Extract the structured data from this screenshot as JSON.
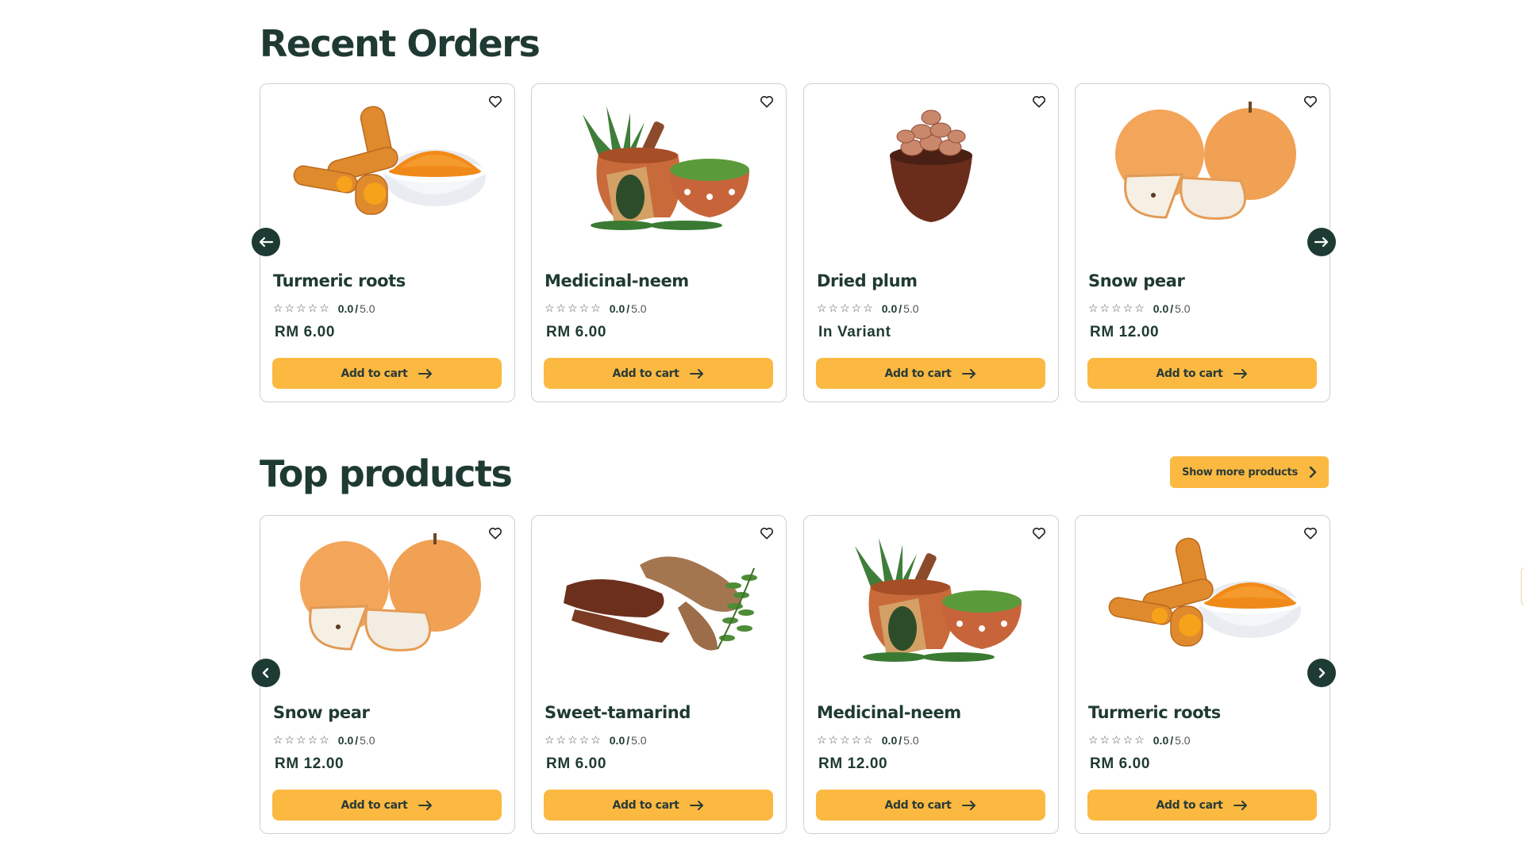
{
  "recent_orders": {
    "title": "Recent Orders",
    "prev_icon": "arrow-left-icon",
    "next_icon": "arrow-right-icon",
    "cards": [
      {
        "name": "Turmeric roots",
        "rating": "0.0",
        "max": "5.0",
        "price": "RM 6.00",
        "cta": "Add to cart",
        "image": "turmeric"
      },
      {
        "name": "Medicinal-neem",
        "rating": "0.0",
        "max": "5.0",
        "price": "RM 6.00",
        "cta": "Add to cart",
        "image": "neem"
      },
      {
        "name": "Dried plum",
        "rating": "0.0",
        "max": "5.0",
        "price": "In Variant",
        "cta": "Add to cart",
        "image": "plum"
      },
      {
        "name": "Snow pear",
        "rating": "0.0",
        "max": "5.0",
        "price": "RM 12.00",
        "cta": "Add to cart",
        "image": "pear"
      }
    ]
  },
  "top_products": {
    "title": "Top products",
    "show_more_label": "Show more products",
    "prev_icon": "chevron-left-icon",
    "next_icon": "chevron-right-icon",
    "cards": [
      {
        "name": "Snow pear",
        "rating": "0.0",
        "max": "5.0",
        "price": "RM 12.00",
        "cta": "Add to cart",
        "image": "pear"
      },
      {
        "name": "Sweet-tamarind",
        "rating": "0.0",
        "max": "5.0",
        "price": "RM 6.00",
        "cta": "Add to cart",
        "image": "tamarind"
      },
      {
        "name": "Medicinal-neem",
        "rating": "0.0",
        "max": "5.0",
        "price": "RM 12.00",
        "cta": "Add to cart",
        "image": "neem"
      },
      {
        "name": "Turmeric roots",
        "rating": "0.0",
        "max": "5.0",
        "price": "RM 6.00",
        "cta": "Add to cart",
        "image": "turmeric"
      }
    ]
  },
  "colors": {
    "accent": "#fbb942",
    "heading": "#1f3a33",
    "nav_button": "#1e3b33",
    "card_border": "#cfcfcf"
  }
}
